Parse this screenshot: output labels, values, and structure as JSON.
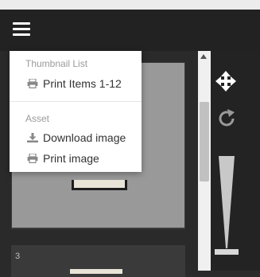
{
  "toolbar": {
    "menu_icon": "hamburger-menu-icon"
  },
  "dropdown": {
    "sections": [
      {
        "header": "Thumbnail List",
        "items": [
          {
            "label": "Print Items 1-12",
            "icon": "printer-icon"
          }
        ]
      },
      {
        "header": "Asset",
        "items": [
          {
            "label": "Download image",
            "icon": "download-icon"
          },
          {
            "label": "Print image",
            "icon": "printer-icon"
          }
        ]
      }
    ]
  },
  "thumbnails": [
    {
      "number": ""
    },
    {
      "number": "3"
    }
  ],
  "controls": {
    "move_icon": "move-arrows-icon",
    "rotate_icon": "rotate-icon",
    "zoom": "zoom-slider"
  },
  "colors": {
    "toolbar": "#222222",
    "panel": "#2a2a2a",
    "menu_bg": "#ffffff",
    "menu_header": "#9a9a9a",
    "menu_text": "#333333"
  }
}
